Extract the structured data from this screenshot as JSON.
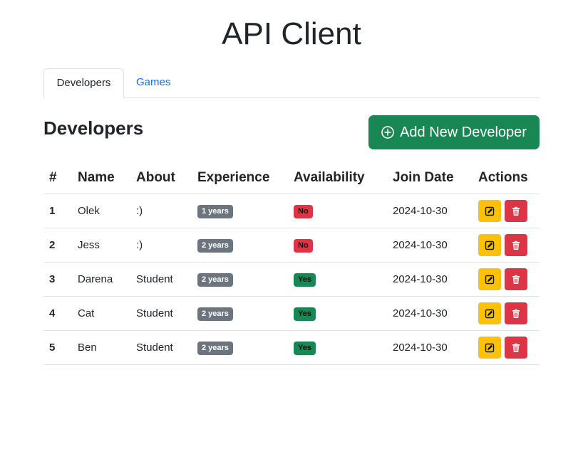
{
  "app": {
    "title": "API Client"
  },
  "tabs": [
    {
      "label": "Developers",
      "active": true
    },
    {
      "label": "Games",
      "active": false
    }
  ],
  "section": {
    "title": "Developers",
    "add_button_label": "Add New Developer"
  },
  "table": {
    "headers": [
      "#",
      "Name",
      "About",
      "Experience",
      "Availability",
      "Join Date",
      "Actions"
    ],
    "rows": [
      {
        "id": "1",
        "name": "Olek",
        "about": ":)",
        "experience": "1 years",
        "availability": "No",
        "join_date": "2024-10-30"
      },
      {
        "id": "2",
        "name": "Jess",
        "about": ":)",
        "experience": "2 years",
        "availability": "No",
        "join_date": "2024-10-30"
      },
      {
        "id": "3",
        "name": "Darena",
        "about": "Student",
        "experience": "2 years",
        "availability": "Yes",
        "join_date": "2024-10-30"
      },
      {
        "id": "4",
        "name": "Cat",
        "about": "Student",
        "experience": "2 years",
        "availability": "Yes",
        "join_date": "2024-10-30"
      },
      {
        "id": "5",
        "name": "Ben",
        "about": "Student",
        "experience": "2 years",
        "availability": "Yes",
        "join_date": "2024-10-30"
      }
    ]
  },
  "icons": {
    "add": "plus-circle-icon",
    "edit": "edit-icon",
    "delete": "trash-icon"
  },
  "colors": {
    "primary_link": "#0d6efd",
    "success": "#198754",
    "danger": "#dc3545",
    "warning": "#ffc107",
    "secondary": "#6c757d"
  }
}
